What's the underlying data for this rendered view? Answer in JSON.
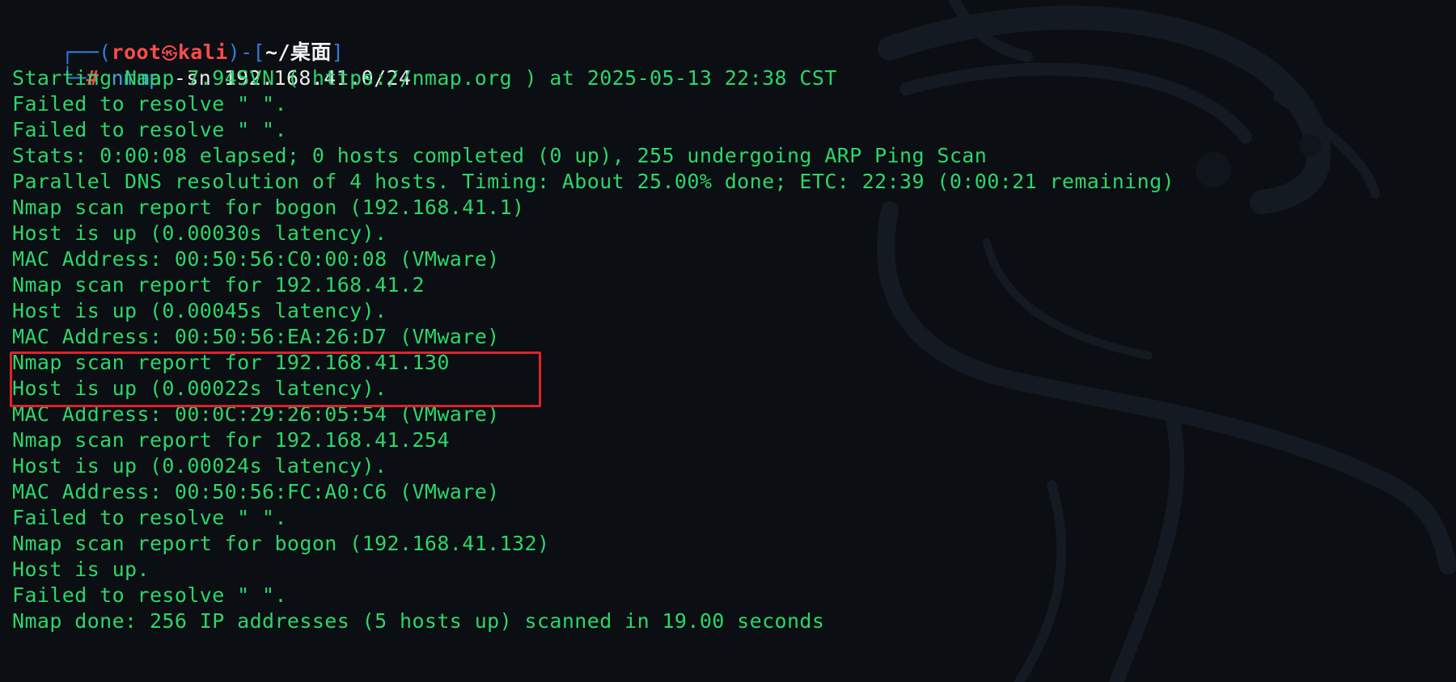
{
  "prompt": {
    "frame_open": "┌──(",
    "user": "root",
    "skull": "㉿",
    "host": "kali",
    "frame_mid": ")-[",
    "path": "~/桌面",
    "frame_close": "]",
    "frame_cmd": "└─",
    "hash": "#"
  },
  "command": {
    "name": "nmap",
    "args": " -sn 192.168.41.0/24"
  },
  "output_lines": [
    "Starting Nmap 7.94SVN ( https://nmap.org ) at 2025-05-13 22:38 CST",
    "Failed to resolve \" \".",
    "Failed to resolve \" \".",
    "Stats: 0:00:08 elapsed; 0 hosts completed (0 up), 255 undergoing ARP Ping Scan",
    "Parallel DNS resolution of 4 hosts. Timing: About 25.00% done; ETC: 22:39 (0:00:21 remaining)",
    "Nmap scan report for bogon (192.168.41.1)",
    "Host is up (0.00030s latency).",
    "MAC Address: 00:50:56:C0:00:08 (VMware)",
    "Nmap scan report for 192.168.41.2",
    "Host is up (0.00045s latency).",
    "MAC Address: 00:50:56:EA:26:D7 (VMware)",
    "Nmap scan report for 192.168.41.130",
    "Host is up (0.00022s latency).",
    "MAC Address: 00:0C:29:26:05:54 (VMware)",
    "Nmap scan report for 192.168.41.254",
    "Host is up (0.00024s latency).",
    "MAC Address: 00:50:56:FC:A0:C6 (VMware)",
    "Failed to resolve \" \".",
    "Nmap scan report for bogon (192.168.41.132)",
    "Host is up.",
    "Failed to resolve \" \".",
    "Nmap done: 256 IP addresses (5 hosts up) scanned in 19.00 seconds"
  ],
  "colors": {
    "background": "#0b0e12",
    "output_text": "#2bd66a",
    "prompt_frame": "#2e7dd6",
    "prompt_user": "#ff4b4b",
    "highlight_border": "#e0222b"
  },
  "icons": {
    "background": "kali-dragon-watermark"
  }
}
